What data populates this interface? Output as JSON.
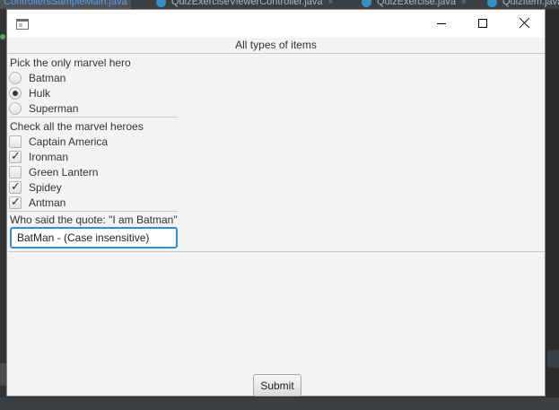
{
  "ide": {
    "tabs": [
      {
        "label": "ControllersSampleMain.java",
        "active": true
      },
      {
        "label": "QuizExerciseViewerController.java",
        "active": false
      },
      {
        "label": "QuizExercise.java",
        "active": false
      },
      {
        "label": "QuizItem.java",
        "active": false
      }
    ],
    "close_glyph": "×"
  },
  "window": {
    "header_title": "All types of items"
  },
  "questions": {
    "q1": {
      "title": "Pick the only marvel hero",
      "options": [
        {
          "label": "Batman",
          "selected": false
        },
        {
          "label": "Hulk",
          "selected": true
        },
        {
          "label": "Superman",
          "selected": false
        }
      ]
    },
    "q2": {
      "title": "Check all the marvel heroes",
      "options": [
        {
          "label": "Captain America",
          "checked": false
        },
        {
          "label": "Ironman",
          "checked": true
        },
        {
          "label": "Green Lantern",
          "checked": false
        },
        {
          "label": "Spidey",
          "checked": true
        },
        {
          "label": "Antman",
          "checked": true
        }
      ],
      "check_glyph": "✓"
    },
    "q3": {
      "title": "Who said the quote: \"I am Batman\"",
      "answer_value": "BatMan - (Case insensitive)"
    }
  },
  "submit_label": "Submit",
  "colors": {
    "focus_border": "#2f8fd3",
    "ide_background": "#2b2b2b",
    "window_background": "#f3f3f3"
  }
}
